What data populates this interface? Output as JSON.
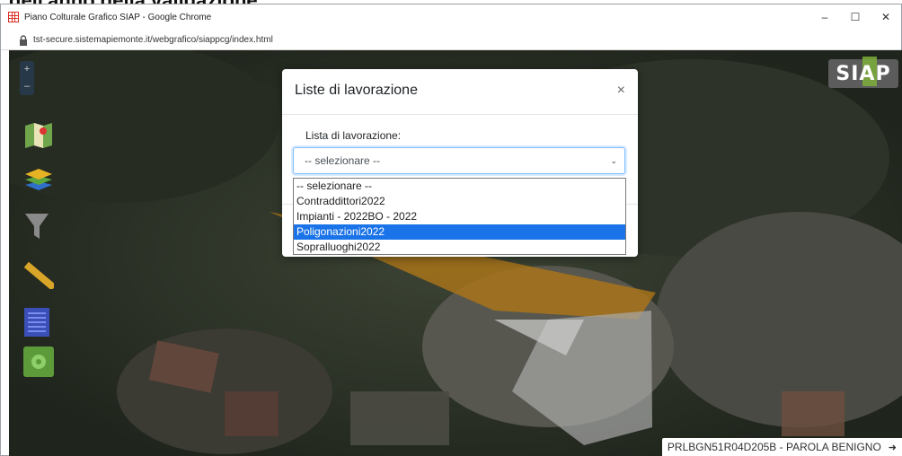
{
  "top_caption": "dell'anno della validazione.",
  "browser": {
    "title": "Piano Colturale Grafico SIAP - Google Chrome",
    "url": "tst-secure.sistemapiemonte.it/webgrafico/siappcg/index.html",
    "minimize": "–",
    "maximize": "☐",
    "close": "✕"
  },
  "map": {
    "zoom_in": "+",
    "zoom_out": "–",
    "logo_text": "SIAP",
    "tools": [
      "map-icon",
      "layers-icon",
      "filter-icon",
      "ruler-icon",
      "list-icon",
      "gear-icon"
    ],
    "user_label": "PRLBGN51R04D205B - PAROLA BENIGNO",
    "user_arrow": "➜"
  },
  "modal": {
    "title": "Liste di lavorazione",
    "close": "×",
    "field_label": "Lista di lavorazione:",
    "selected": "-- selezionare --",
    "options": [
      "-- selezionare --",
      "Contraddittori2022",
      "Impianti - 2022BO - 2022",
      "Poligonazioni2022",
      "Sopralluoghi2022"
    ],
    "highlighted_index": 3
  },
  "colors": {
    "highlight": "#1a73e8",
    "logo_green": "#7cae3a",
    "favicon_red": "#d93025"
  }
}
